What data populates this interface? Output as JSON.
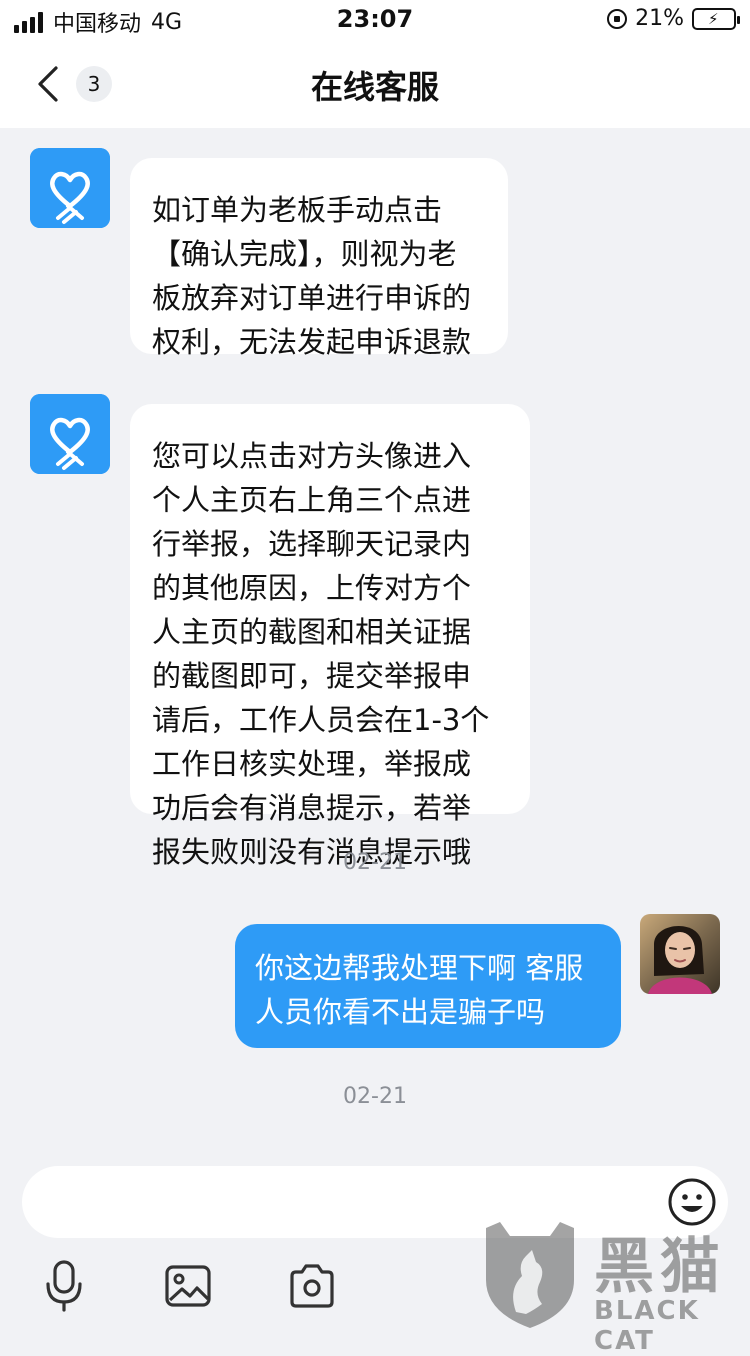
{
  "status_bar": {
    "carrier": "中国移动",
    "network": "4G",
    "time": "23:07",
    "battery": "21%",
    "battery_level": 0.21
  },
  "header": {
    "back_icon": "chevron-left-icon",
    "unread_count": "3",
    "title": "在线客服"
  },
  "messages": [
    {
      "sender": "agent",
      "lines": [
        "如订单为老板手动点击",
        "【确认完成】，则视为老",
        "板放弃对订单进行申诉的",
        "权利，无法发起申诉退款"
      ]
    },
    {
      "sender": "agent",
      "lines": [
        "您可以点击对方头像进入",
        "个人主页右上角三个点进",
        "行举报，选择聊天记录内",
        "的其他原因，上传对方个",
        "人主页的截图和相关证据",
        "的截图即可，提交举报申",
        "请后，工作人员会在1-3个",
        "工作日核实处理，举报成",
        "功后会有消息提示，若举",
        "报失败则没有消息提示哦"
      ]
    },
    {
      "sender": "timestamp",
      "text": "02-21"
    },
    {
      "sender": "user",
      "lines": [
        "你这边帮我处理下啊 客服",
        "人员你看不出是骗子吗"
      ]
    },
    {
      "sender": "timestamp",
      "text": "02-21"
    }
  ],
  "input": {
    "placeholder": "",
    "value": ""
  },
  "toolbar": {
    "icons": [
      "microphone-icon",
      "image-icon",
      "camera-icon",
      "emoji-icon"
    ]
  },
  "watermark": {
    "text": "黑猫",
    "subtext": "BLACK CAT"
  },
  "colors": {
    "accent": "#2e9bf6",
    "background": "#f1f2f5",
    "bubble_in": "#ffffff"
  }
}
